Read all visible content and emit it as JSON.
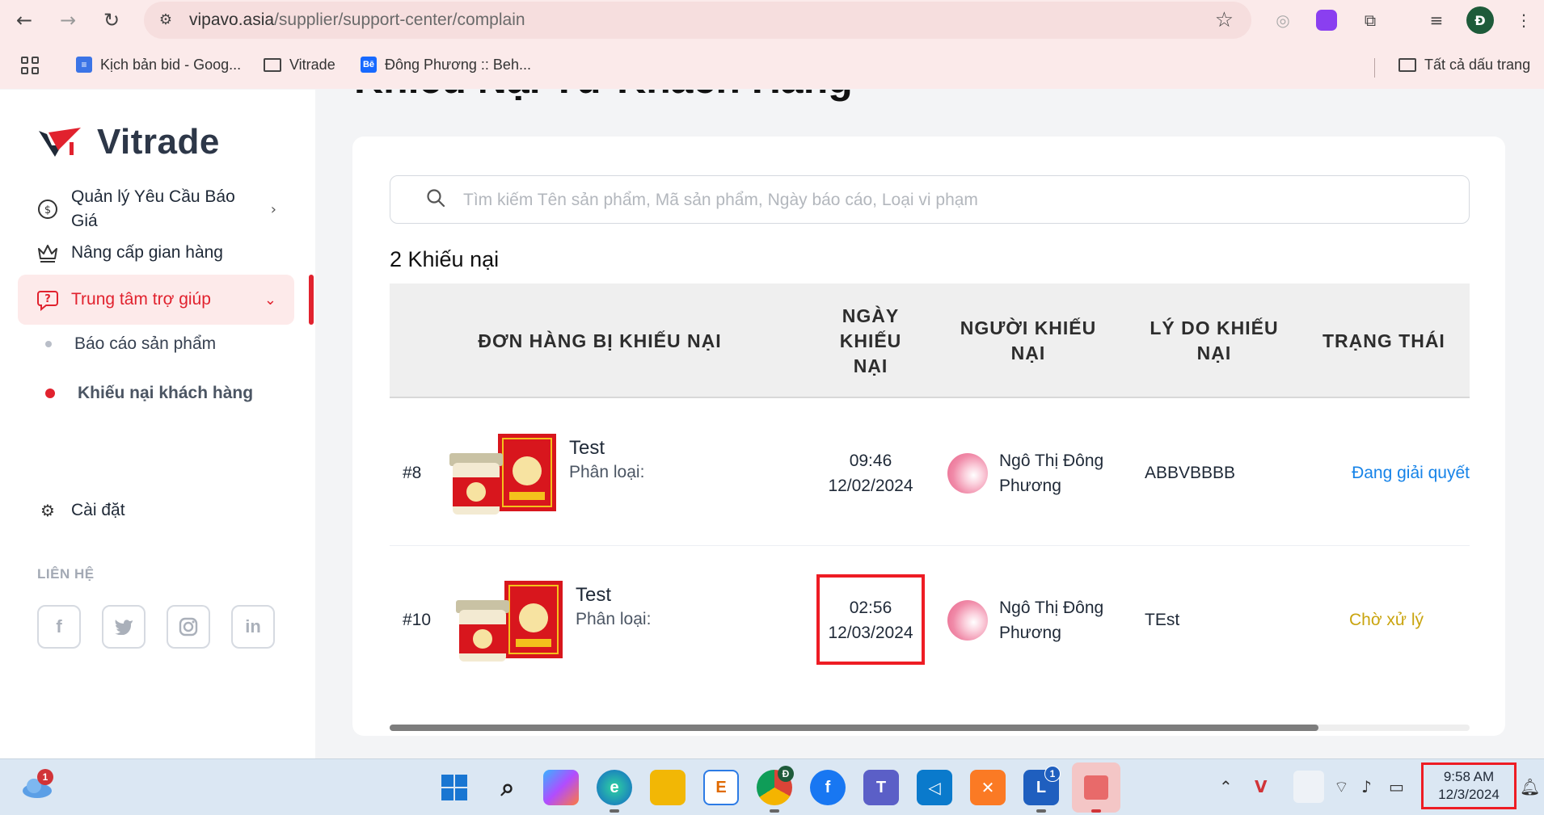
{
  "browser": {
    "url_host": "vipavo.asia",
    "url_path": "/supplier/support-center/complain",
    "bookmarks": [
      {
        "label": "Kịch bản bid - Goog...",
        "icon": "google-docs-icon"
      },
      {
        "label": "Vitrade",
        "icon": "folder-icon"
      },
      {
        "label": "Đông Phương :: Beh...",
        "icon": "behance-icon"
      }
    ],
    "all_bookmarks_label": "Tất cả dấu trang",
    "profile_initial": "Đ"
  },
  "sidebar": {
    "logo_text": "Vitrade",
    "items": [
      {
        "label_line1": "Quản lý Yêu Cầu Báo",
        "label_line2": "Giá",
        "icon": "dollar-cycle-icon"
      },
      {
        "label": "Nâng cấp gian hàng",
        "icon": "crown-icon"
      },
      {
        "label": "Trung tâm trợ giúp",
        "icon": "help-chat-icon",
        "active": true
      },
      {
        "label": "Cài đặt",
        "icon": "gear-icon"
      }
    ],
    "sub_items": [
      {
        "label": "Báo cáo sản phẩm"
      },
      {
        "label": "Khiếu nại khách hàng",
        "active": true
      }
    ],
    "contact_label": "LIÊN HỆ",
    "social": [
      "facebook-icon",
      "twitter-icon",
      "instagram-icon",
      "linkedin-icon"
    ]
  },
  "main": {
    "heading": "Khiếu Nại Từ Khách Hàng",
    "search_placeholder": "Tìm kiếm Tên sản phẩm, Mã sản phẩm, Ngày báo cáo, Loại vi phạm",
    "count_label": "2 Khiếu nại",
    "table": {
      "headers": {
        "order": "ĐƠN HÀNG BỊ KHIẾU NẠI",
        "date_l1": "NGÀY",
        "date_l2": "KHIẾU",
        "date_l3": "NẠI",
        "user_l1": "NGƯỜI KHIẾU",
        "user_l2": "NẠI",
        "reason_l1": "LÝ DO KHIẾU",
        "reason_l2": "NẠI",
        "status": "TRẠNG THÁI"
      },
      "rows": [
        {
          "id": "#8",
          "product": "Test",
          "variant": "Phân loại:",
          "time": "09:46",
          "date": "12/02/2024",
          "user_l1": "Ngô Thị Đông",
          "user_l2": "Phương",
          "reason": "ABBVBBBB",
          "status": "Đang giải quyết",
          "status_color": "#1683e8"
        },
        {
          "id": "#10",
          "product": "Test",
          "variant": "Phân loại:",
          "time": "02:56",
          "date": "12/03/2024",
          "user_l1": "Ngô Thị Đông",
          "user_l2": "Phương",
          "reason": "TEst",
          "status": "Chờ xử lý",
          "status_color": "#c9a40e"
        }
      ],
      "horizontal_scroll_position": 0.86
    }
  },
  "taskbar": {
    "clock_time": "9:58 AM",
    "clock_date": "12/3/2024",
    "weather_badge": "1",
    "l_app_badge": "1",
    "chrome_badge": "Đ"
  },
  "colors": {
    "accent_red": "#e1222e",
    "status_blue": "#1683e8",
    "status_yellow": "#c9a40e"
  }
}
